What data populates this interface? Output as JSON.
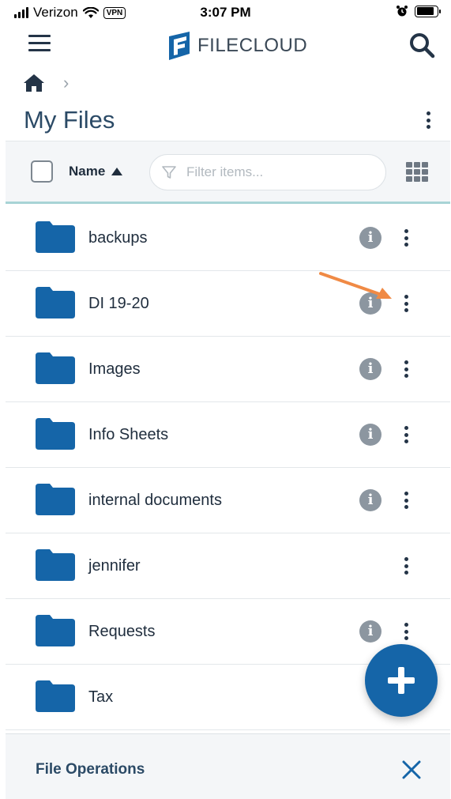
{
  "status_bar": {
    "carrier": "Verizon",
    "vpn_label": "VPN",
    "time": "3:07 PM",
    "battery_level": 0.85
  },
  "header": {
    "brand_prefix": "FILE",
    "brand_suffix": "CLOUD",
    "menu_icon": "hamburger-icon",
    "search_icon": "search-icon"
  },
  "breadcrumb": {
    "home_icon": "home-icon",
    "separator": "›"
  },
  "page": {
    "title": "My Files"
  },
  "toolbar": {
    "sort_label": "Name",
    "sort_direction": "ascending",
    "filter_placeholder": "Filter items...",
    "filter_value": ""
  },
  "files": [
    {
      "name": "backups",
      "has_info": true
    },
    {
      "name": "DI 19-20",
      "has_info": true
    },
    {
      "name": "Images",
      "has_info": true
    },
    {
      "name": "Info Sheets",
      "has_info": true
    },
    {
      "name": "internal documents",
      "has_info": true
    },
    {
      "name": "jennifer",
      "has_info": false
    },
    {
      "name": "Requests",
      "has_info": true
    },
    {
      "name": "Tax",
      "has_info": false
    }
  ],
  "bottom_bar": {
    "label": "File Operations"
  },
  "colors": {
    "folder": "#1565a8",
    "fab": "#1565a8",
    "title": "#2b4a66",
    "annotation_arrow": "#f08a45",
    "toolbar_underline": "#a8d4d6"
  }
}
